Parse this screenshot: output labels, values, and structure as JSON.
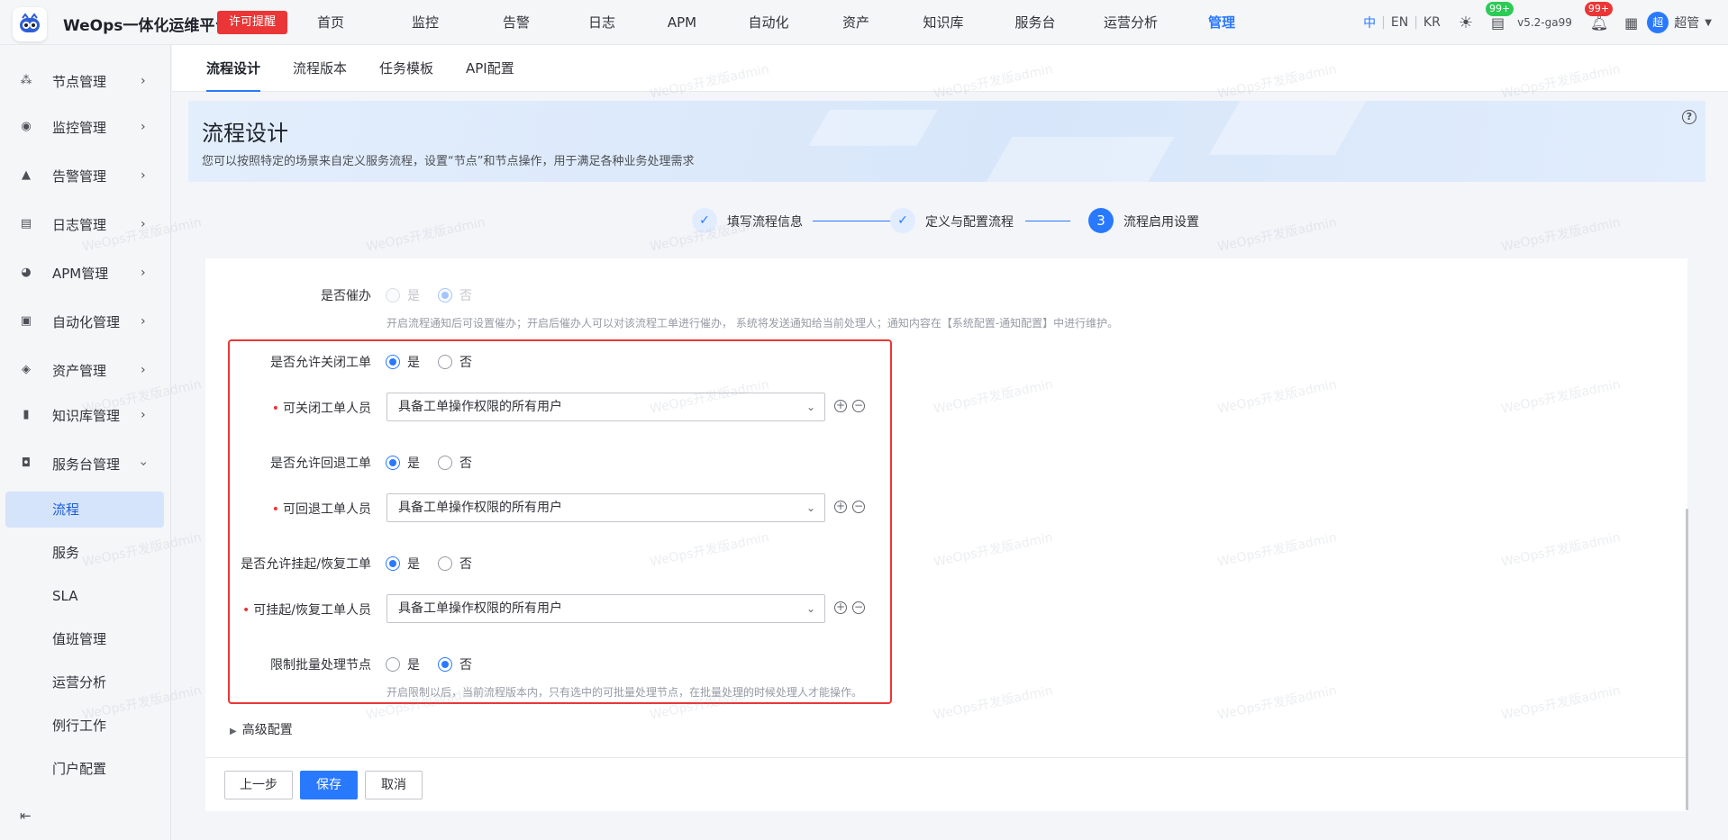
{
  "brand": {
    "title": "WeOps一体化运维平台",
    "license_button": "许可提醒"
  },
  "nav": [
    "首页",
    "监控",
    "告警",
    "日志",
    "APM",
    "自动化",
    "资产",
    "知识库",
    "服务台",
    "运营分析",
    "管理"
  ],
  "nav_active": "管理",
  "topright": {
    "lang_zh": "中",
    "lang_en": "EN",
    "lang_kr": "KR",
    "version": "v5.2-ga99",
    "badge_doc": "99+",
    "badge_bell": "99+",
    "user_avatar": "超",
    "user_name": "超管"
  },
  "sidebar": {
    "groups": [
      {
        "label": "节点管理",
        "icon": "node-icon"
      },
      {
        "label": "监控管理",
        "icon": "monitor-icon"
      },
      {
        "label": "告警管理",
        "icon": "alert-icon"
      },
      {
        "label": "日志管理",
        "icon": "log-icon"
      },
      {
        "label": "APM管理",
        "icon": "apm-icon"
      },
      {
        "label": "自动化管理",
        "icon": "automation-icon"
      },
      {
        "label": "资产管理",
        "icon": "asset-icon"
      },
      {
        "label": "知识库管理",
        "icon": "knowledge-icon"
      },
      {
        "label": "服务台管理",
        "icon": "service-desk-icon"
      }
    ],
    "sub_items": [
      "流程",
      "服务",
      "SLA",
      "值班管理",
      "运营分析",
      "例行工作",
      "门户配置"
    ],
    "active_sub": "流程"
  },
  "tabs": [
    "流程设计",
    "流程版本",
    "任务模板",
    "API配置"
  ],
  "banner": {
    "title": "流程设计",
    "desc": "您可以按照特定的场景来自定义服务流程，设置“节点”和节点操作，用于满足各种业务处理需求"
  },
  "steps": [
    {
      "label": "填写流程信息",
      "state": "done"
    },
    {
      "label": "定义与配置流程",
      "state": "done"
    },
    {
      "label": "流程启用设置",
      "state": "current",
      "num": "3"
    }
  ],
  "form": {
    "urge": {
      "label": "是否催办",
      "yes": "是",
      "no": "否",
      "selected": "否",
      "hint": "开启流程通知后可设置催办；开启后催办人可以对该流程工单进行催办， 系统将发送通知给当前处理人；通知内容在【系统配置-通知配置】中进行维护。"
    },
    "allow_close": {
      "label": "是否允许关闭工单",
      "yes": "是",
      "no": "否",
      "selected": "是"
    },
    "close_users": {
      "label": "可关闭工单人员",
      "value": "具备工单操作权限的所有用户"
    },
    "allow_rollback": {
      "label": "是否允许回退工单",
      "yes": "是",
      "no": "否",
      "selected": "是"
    },
    "rollback_users": {
      "label": "可回退工单人员",
      "value": "具备工单操作权限的所有用户"
    },
    "allow_suspend": {
      "label": "是否允许挂起/恢复工单",
      "yes": "是",
      "no": "否",
      "selected": "是"
    },
    "suspend_users": {
      "label": "可挂起/恢复工单人员",
      "value": "具备工单操作权限的所有用户"
    },
    "batch_limit": {
      "label": "限制批量处理节点",
      "yes": "是",
      "no": "否",
      "selected": "否",
      "hint": "开启限制以后，当前流程版本内，只有选中的可批量处理节点，在批量处理的时候处理人才能操作。"
    }
  },
  "advanced": "高级配置",
  "buttons": {
    "prev": "上一步",
    "save": "保存",
    "cancel": "取消"
  },
  "watermark": "WeOps开发版admin",
  "colors": {
    "primary": "#2979ff",
    "danger": "#ea3636",
    "success": "#2dcb56"
  }
}
